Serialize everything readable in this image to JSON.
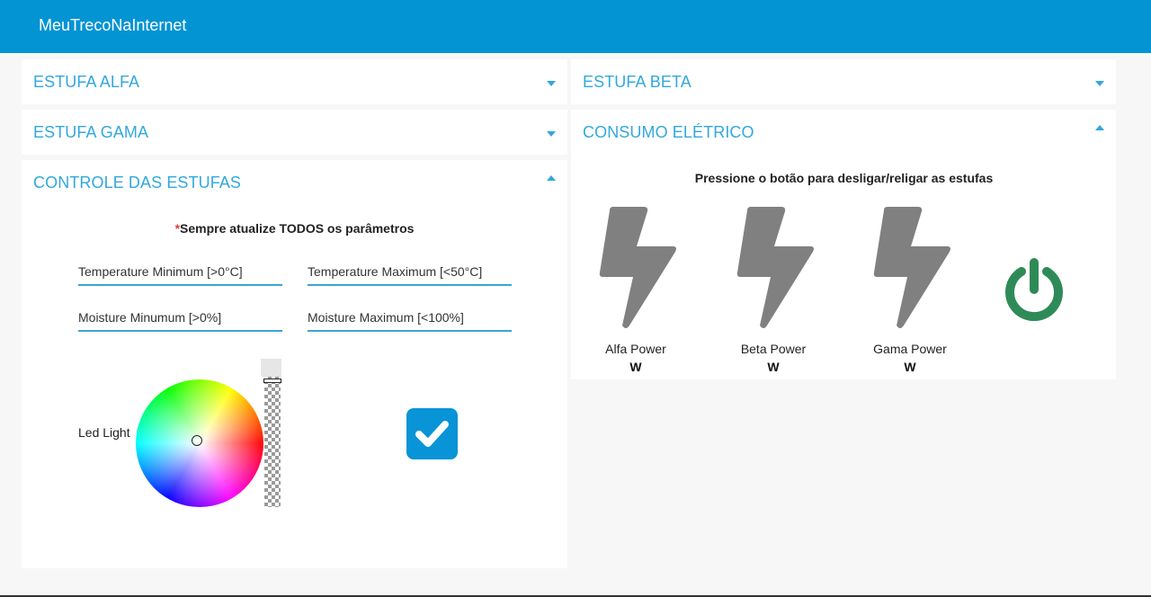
{
  "app": {
    "title": "MeuTrecoNaInternet"
  },
  "panels": {
    "alfa": {
      "title": "ESTUFA ALFA"
    },
    "beta": {
      "title": "ESTUFA BETA"
    },
    "gama": {
      "title": "ESTUFA GAMA"
    },
    "consumo": {
      "title": "CONSUMO ELÉTRICO",
      "subtitle": "Pressione o botão para desligar/religar as estufas",
      "meters": [
        {
          "label": "Alfa Power",
          "unit": "W"
        },
        {
          "label": "Beta Power",
          "unit": "W"
        },
        {
          "label": "Gama Power",
          "unit": "W"
        }
      ]
    },
    "controle": {
      "title": "CONTROLE DAS ESTUFAS",
      "note_star": "*",
      "note": "Sempre atualize TODOS os parâmetros",
      "fields": {
        "temp_min": "Temperature Minimum [>0°C]",
        "temp_max": "Temperature Maximum [<50°C]",
        "moist_min": "Moisture Minumum [>0%]",
        "moist_max": "Moisture Maximum [<100%]"
      },
      "led_label": "Led Light",
      "confirmed": true
    }
  },
  "colors": {
    "accent": "#0394d4",
    "panel_title": "#32a8dd",
    "bolt": "#808080",
    "power_button": "#2e8b57",
    "checkbox": "#0894d6"
  },
  "icons": {
    "meter": "bolt-icon",
    "power": "power-icon",
    "check": "checkmark-icon",
    "expand": "chevron-down-icon",
    "collapse": "chevron-up-icon"
  }
}
